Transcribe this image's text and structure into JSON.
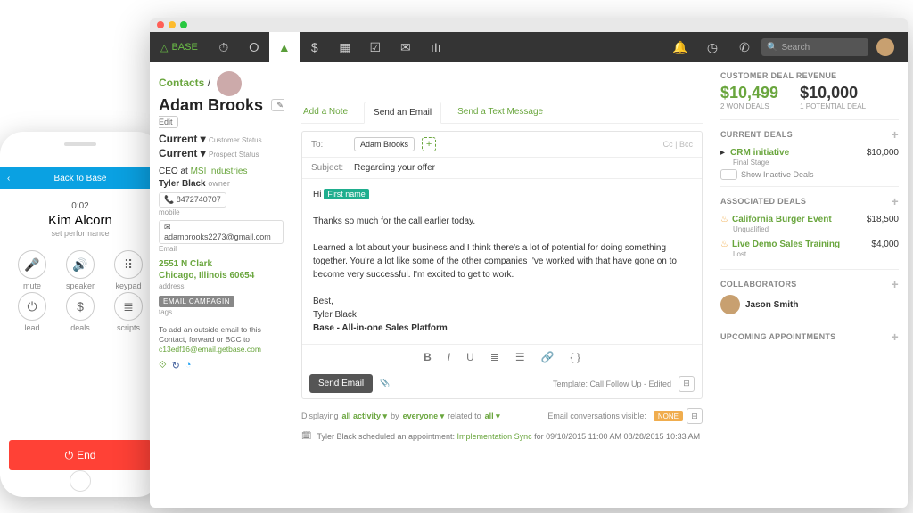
{
  "phone": {
    "bar": "Back to Base",
    "timer": "0:02",
    "name": "Kim Alcorn",
    "sub": "set performance",
    "buttons": [
      "mute",
      "speaker",
      "keypad",
      "lead",
      "deals",
      "scripts"
    ],
    "end": "End"
  },
  "nav": {
    "brand": "BASE",
    "search": "Search"
  },
  "crumb": {
    "root": "Contacts",
    "sep": "/",
    "name": "Adam Brooks",
    "edit": "✎ Edit"
  },
  "left": {
    "status1": "Current ▾",
    "status1_sub": "Customer Status",
    "status2": "Current ▾",
    "status2_sub": "Prospect Status",
    "title": "CEO at ",
    "company": "MSI Industries",
    "owner": "Tyler Black",
    "owner_sub": "owner",
    "phone": "8472740707",
    "phone_sub": "mobile",
    "email": "adambrooks2273@gmail.com",
    "email_sub": "Email",
    "addr1": "2551 N Clark",
    "addr2": "Chicago, Illinois 60654",
    "addr_sub": "address",
    "tag": "EMAIL CAMPAGIN",
    "tag_sub": "tags",
    "hint1": "To add an outside email to this Contact, forward or BCC to",
    "hint_email": "c13edf16@email.getbase.com"
  },
  "tabs": {
    "note": "Add a Note",
    "email": "Send an Email",
    "text": "Send a Text Message"
  },
  "compose": {
    "to_lbl": "To:",
    "to_chip": "Adam Brooks",
    "ccbcc": "Cc | Bcc",
    "subj_lbl": "Subject:",
    "subj": "Regarding your offer",
    "hi": "Hi ",
    "fn": "First name",
    "p1": "Thanks so much for the call earlier today.",
    "p2": "Learned a lot about your business and I think there's a lot of potential for doing something together. You're a lot like some of the other companies I've worked with that have gone on to become very successful. I'm excited to get to work.",
    "sig1": "Best,",
    "sig2": "Tyler Black",
    "sig3": "Base - All-in-one Sales Platform",
    "send": "Send Email",
    "tmpl": "Template: Call Follow Up - Edited"
  },
  "filter": {
    "pre": "Displaying",
    "a": "all activity ▾",
    "by": "by",
    "b": "everyone ▾",
    "rel": "related to",
    "c": "all ▾",
    "vis": "Email conversations visible:",
    "none": "NONE"
  },
  "feed": {
    "who": "Tyler Black scheduled an appointment:",
    "link": "Implementation Sync",
    "rest": "for 09/10/2015 11:00 AM 08/28/2015 10:33 AM"
  },
  "right": {
    "rev_h": "CUSTOMER DEAL REVENUE",
    "won": "$10,499",
    "won_sub": "2 WON DEALS",
    "pot": "$10,000",
    "pot_sub": "1 POTENTIAL DEAL",
    "cur_h": "CURRENT DEALS",
    "cur_name": "CRM initiative",
    "cur_stage": "Final Stage",
    "cur_amt": "$10,000",
    "show": "Show Inactive Deals",
    "assoc_h": "ASSOCIATED DEALS",
    "d1": "California Burger Event",
    "d1s": "Unqualified",
    "d1a": "$18,500",
    "d2": "Live Demo Sales Training",
    "d2s": "Lost",
    "d2a": "$4,000",
    "coll_h": "COLLABORATORS",
    "coll": "Jason Smith",
    "up_h": "UPCOMING APPOINTMENTS"
  }
}
